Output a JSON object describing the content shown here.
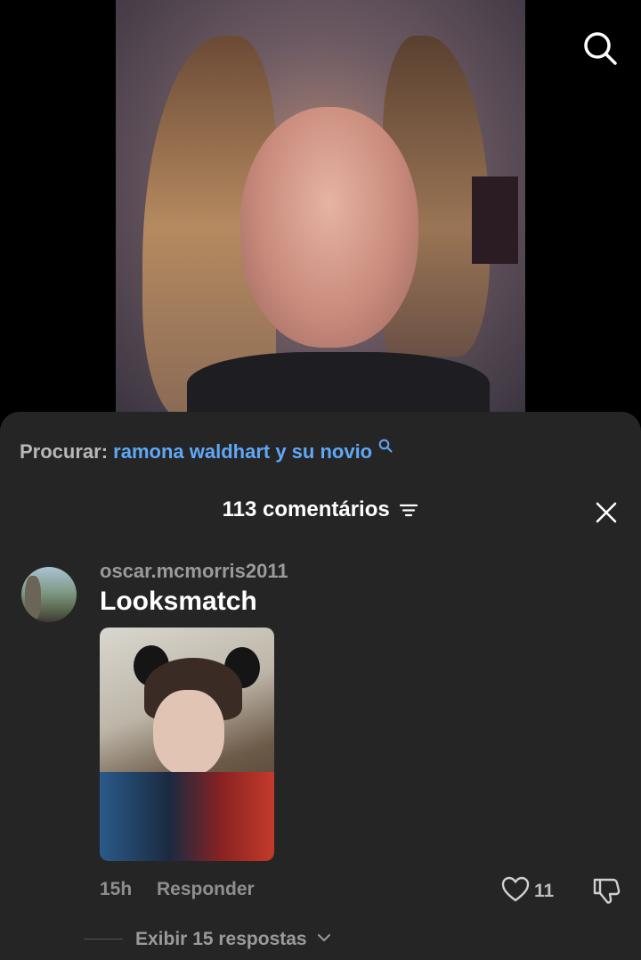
{
  "search_prefix": "Procurar:",
  "search_query": "ramona waldhart y su novio",
  "header": {
    "comment_count_label": "113 comentários"
  },
  "comment": {
    "username": "oscar.mcmorris2011",
    "text": "Looksmatch",
    "time": "15h",
    "reply_label": "Responder",
    "likes": "11",
    "view_replies_label": "Exibir 15 respostas"
  },
  "colors": {
    "sheet_bg": "#252525",
    "query_link": "#60a8f5",
    "muted_text": "#8f8f8f"
  },
  "icons": [
    "search-icon",
    "sort-icon",
    "close-icon",
    "heart-icon",
    "dislike-icon",
    "chevron-down-icon"
  ]
}
